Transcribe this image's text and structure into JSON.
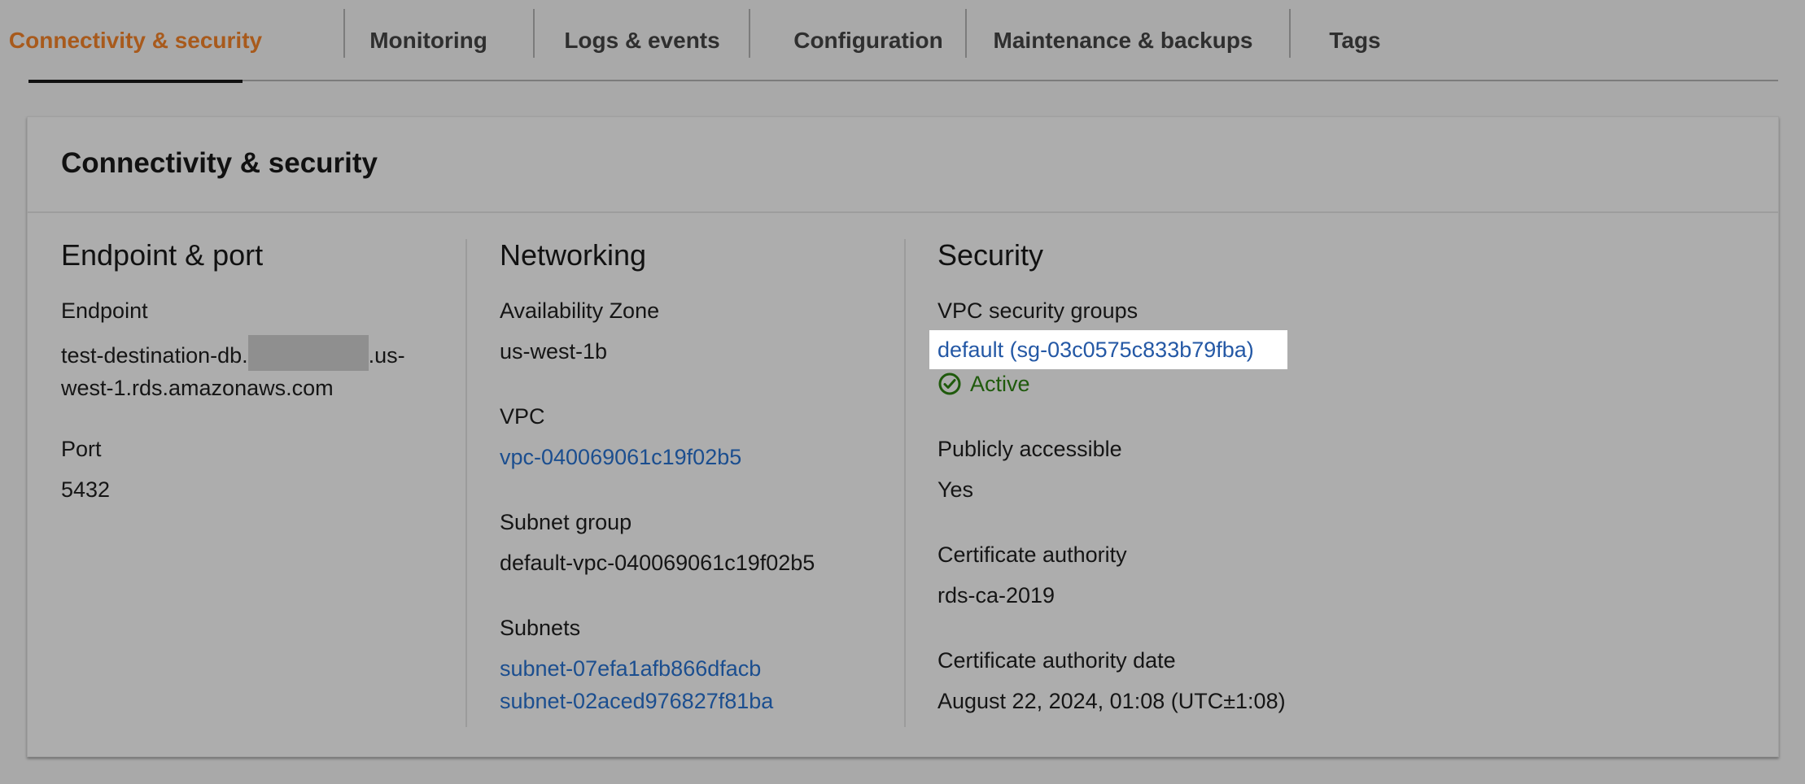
{
  "tabs": [
    {
      "label": "Connectivity & security"
    },
    {
      "label": "Monitoring"
    },
    {
      "label": "Logs & events"
    },
    {
      "label": "Configuration"
    },
    {
      "label": "Maintenance & backups"
    },
    {
      "label": "Tags"
    }
  ],
  "card": {
    "title": "Connectivity & security"
  },
  "endpoint_port": {
    "heading": "Endpoint & port",
    "endpoint_label": "Endpoint",
    "endpoint_value_prefix": "test-destination-db.",
    "endpoint_value_suffix": ".us-west-1.rds.amazonaws.com",
    "port_label": "Port",
    "port_value": "5432"
  },
  "networking": {
    "heading": "Networking",
    "az_label": "Availability Zone",
    "az_value": "us-west-1b",
    "vpc_label": "VPC",
    "vpc_value": "vpc-040069061c19f02b5",
    "subnet_group_label": "Subnet group",
    "subnet_group_value": "default-vpc-040069061c19f02b5",
    "subnets_label": "Subnets",
    "subnets": [
      "subnet-07efa1afb866dfacb",
      "subnet-02aced976827f81ba"
    ]
  },
  "security": {
    "heading": "Security",
    "vpc_sg_label": "VPC security groups",
    "vpc_sg_value": "default (sg-03c0575c833b79fba)",
    "status_value": "Active",
    "public_label": "Publicly accessible",
    "public_value": "Yes",
    "ca_label": "Certificate authority",
    "ca_value": "rds-ca-2019",
    "ca_date_label": "Certificate authority date",
    "ca_date_value": "August 22, 2024, 01:08 (UTC±1:08)"
  },
  "colors": {
    "active_tab": "#a85a1c",
    "link": "#1b4e8f",
    "status_green": "#1f5a0c",
    "background": "#a9a9a9"
  },
  "icons": {
    "status": "check-circle-icon"
  }
}
